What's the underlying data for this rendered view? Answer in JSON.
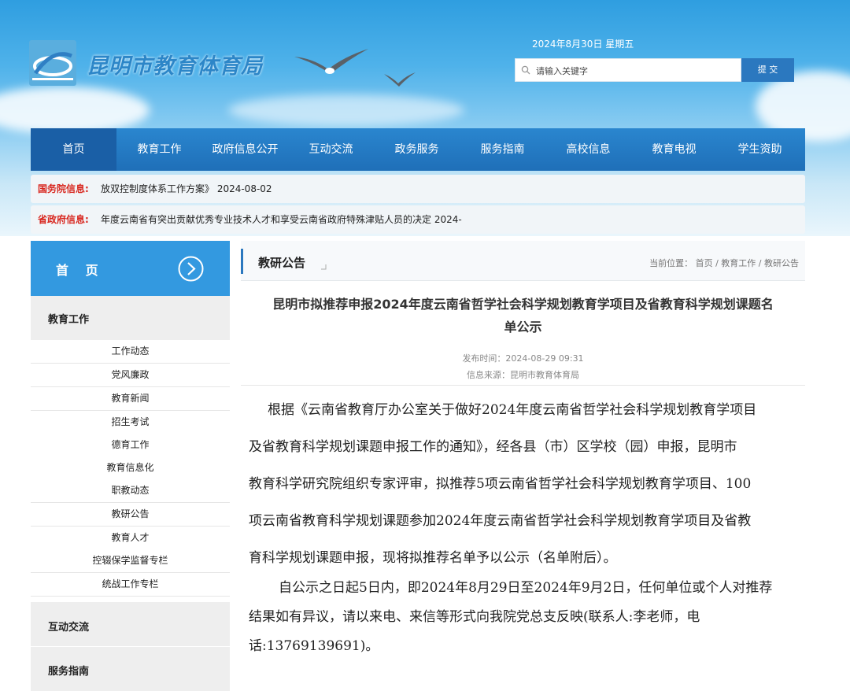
{
  "header": {
    "site_title": "昆明市教育体育局",
    "date": "2024年8月30日 星期五",
    "search_placeholder": "请输入关键字",
    "search_button": "提 交"
  },
  "nav": {
    "items": [
      "首页",
      "教育工作",
      "政府信息公开",
      "互动交流",
      "政务服务",
      "服务指南",
      "高校信息",
      "教育电视",
      "学生资助"
    ]
  },
  "tickers": [
    {
      "label": "国务院信息:",
      "text": "放双控制度体系工作方案》 2024-08-02"
    },
    {
      "label": "省政府信息:",
      "text": "年度云南省有突出贡献优秀专业技术人才和享受云南省政府特殊津贴人员的决定 2024-"
    }
  ],
  "sidebar": {
    "home_label": "首 页",
    "sections": [
      {
        "title": "教育工作",
        "items": [
          "工作动态",
          "党风廉政",
          "教育新闻",
          "招生考试",
          "德育工作",
          "教育信息化",
          "职教动态",
          "教研公告",
          "教育人才",
          "控辍保学监督专栏",
          "统战工作专栏"
        ]
      },
      {
        "title": "互动交流",
        "items": []
      },
      {
        "title": "服务指南",
        "items": []
      }
    ]
  },
  "main": {
    "section_title": "教研公告",
    "breadcrumb": "当前位置： 首页 / 教育工作 / 教研公告",
    "article": {
      "title_line1": "昆明市拟推荐申报2024年度云南省哲学社会科学规划教育学项目及省教育科学规划课题名",
      "title_line2": "单公示",
      "publish_time": "发布时间：2024-08-29 09:31",
      "source": "信息来源：昆明市教育体育局",
      "paragraphs": [
        [
          "根据《云南省教育厅办公室关于做好2024年度云南省哲学社会科学规划教育学项目",
          "及省教育科学规划课题申报工作的通知》，经各县（市）区学校（园）申报，昆明市",
          "教育科学研究院组织专家评审，拟推荐5项云南省哲学社会科学规划教育学项目、100",
          "项云南省教育科学规划课题参加2024年度云南省哲学社会科学规划教育学项目及省教",
          "育科学规划课题申报，现将拟推荐名单予以公示（名单附后）。"
        ],
        [
          "自公示之日起5日内，即2024年8月29日至2024年9月2日，任何单位或个人对推荐",
          "结果如有异议，请以来电、来信等形式向我院党总支反映(联系人:李老师，电",
          "话:13769139691)。"
        ]
      ]
    }
  },
  "colors": {
    "nav_blue": "#2a86cf",
    "label_red": "#d8261e",
    "sidebar_blue": "#3399e0"
  }
}
